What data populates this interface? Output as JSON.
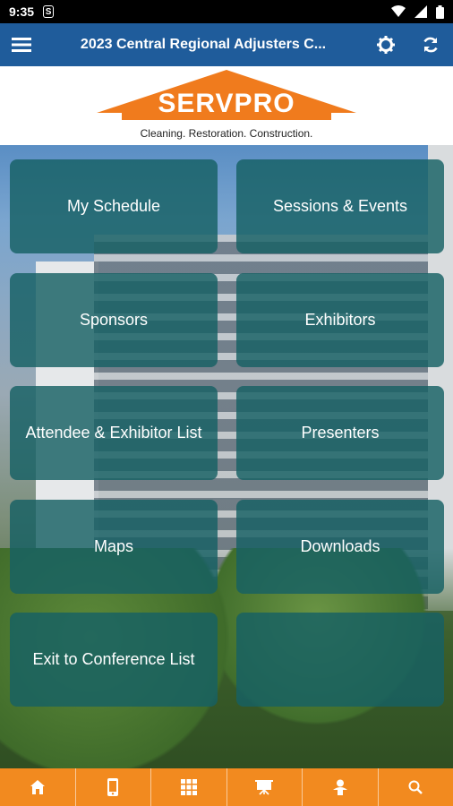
{
  "status_bar": {
    "time": "9:35",
    "notification_icon": "S"
  },
  "app_bar": {
    "title": "2023 Central Regional Adjusters C..."
  },
  "banner": {
    "logo_text": "SERVPRO",
    "tagline": "Cleaning. Restoration. Construction."
  },
  "tiles": [
    {
      "label": "My Schedule"
    },
    {
      "label": "Sessions & Events"
    },
    {
      "label": "Sponsors"
    },
    {
      "label": "Exhibitors"
    },
    {
      "label": "Attendee & Exhibitor List"
    },
    {
      "label": "Presenters"
    },
    {
      "label": "Maps"
    },
    {
      "label": "Downloads"
    },
    {
      "label": "Exit to Conference List"
    },
    {
      "label": ""
    }
  ],
  "tab_bar": {
    "icons": [
      "home-icon",
      "mobile-phone-icon",
      "grid-icon",
      "presentation-board-icon",
      "person-icon",
      "search-icon"
    ]
  },
  "colors": {
    "app_bar": "#1f5c9b",
    "accent_orange": "#f28a1f",
    "tile": "#166064"
  }
}
